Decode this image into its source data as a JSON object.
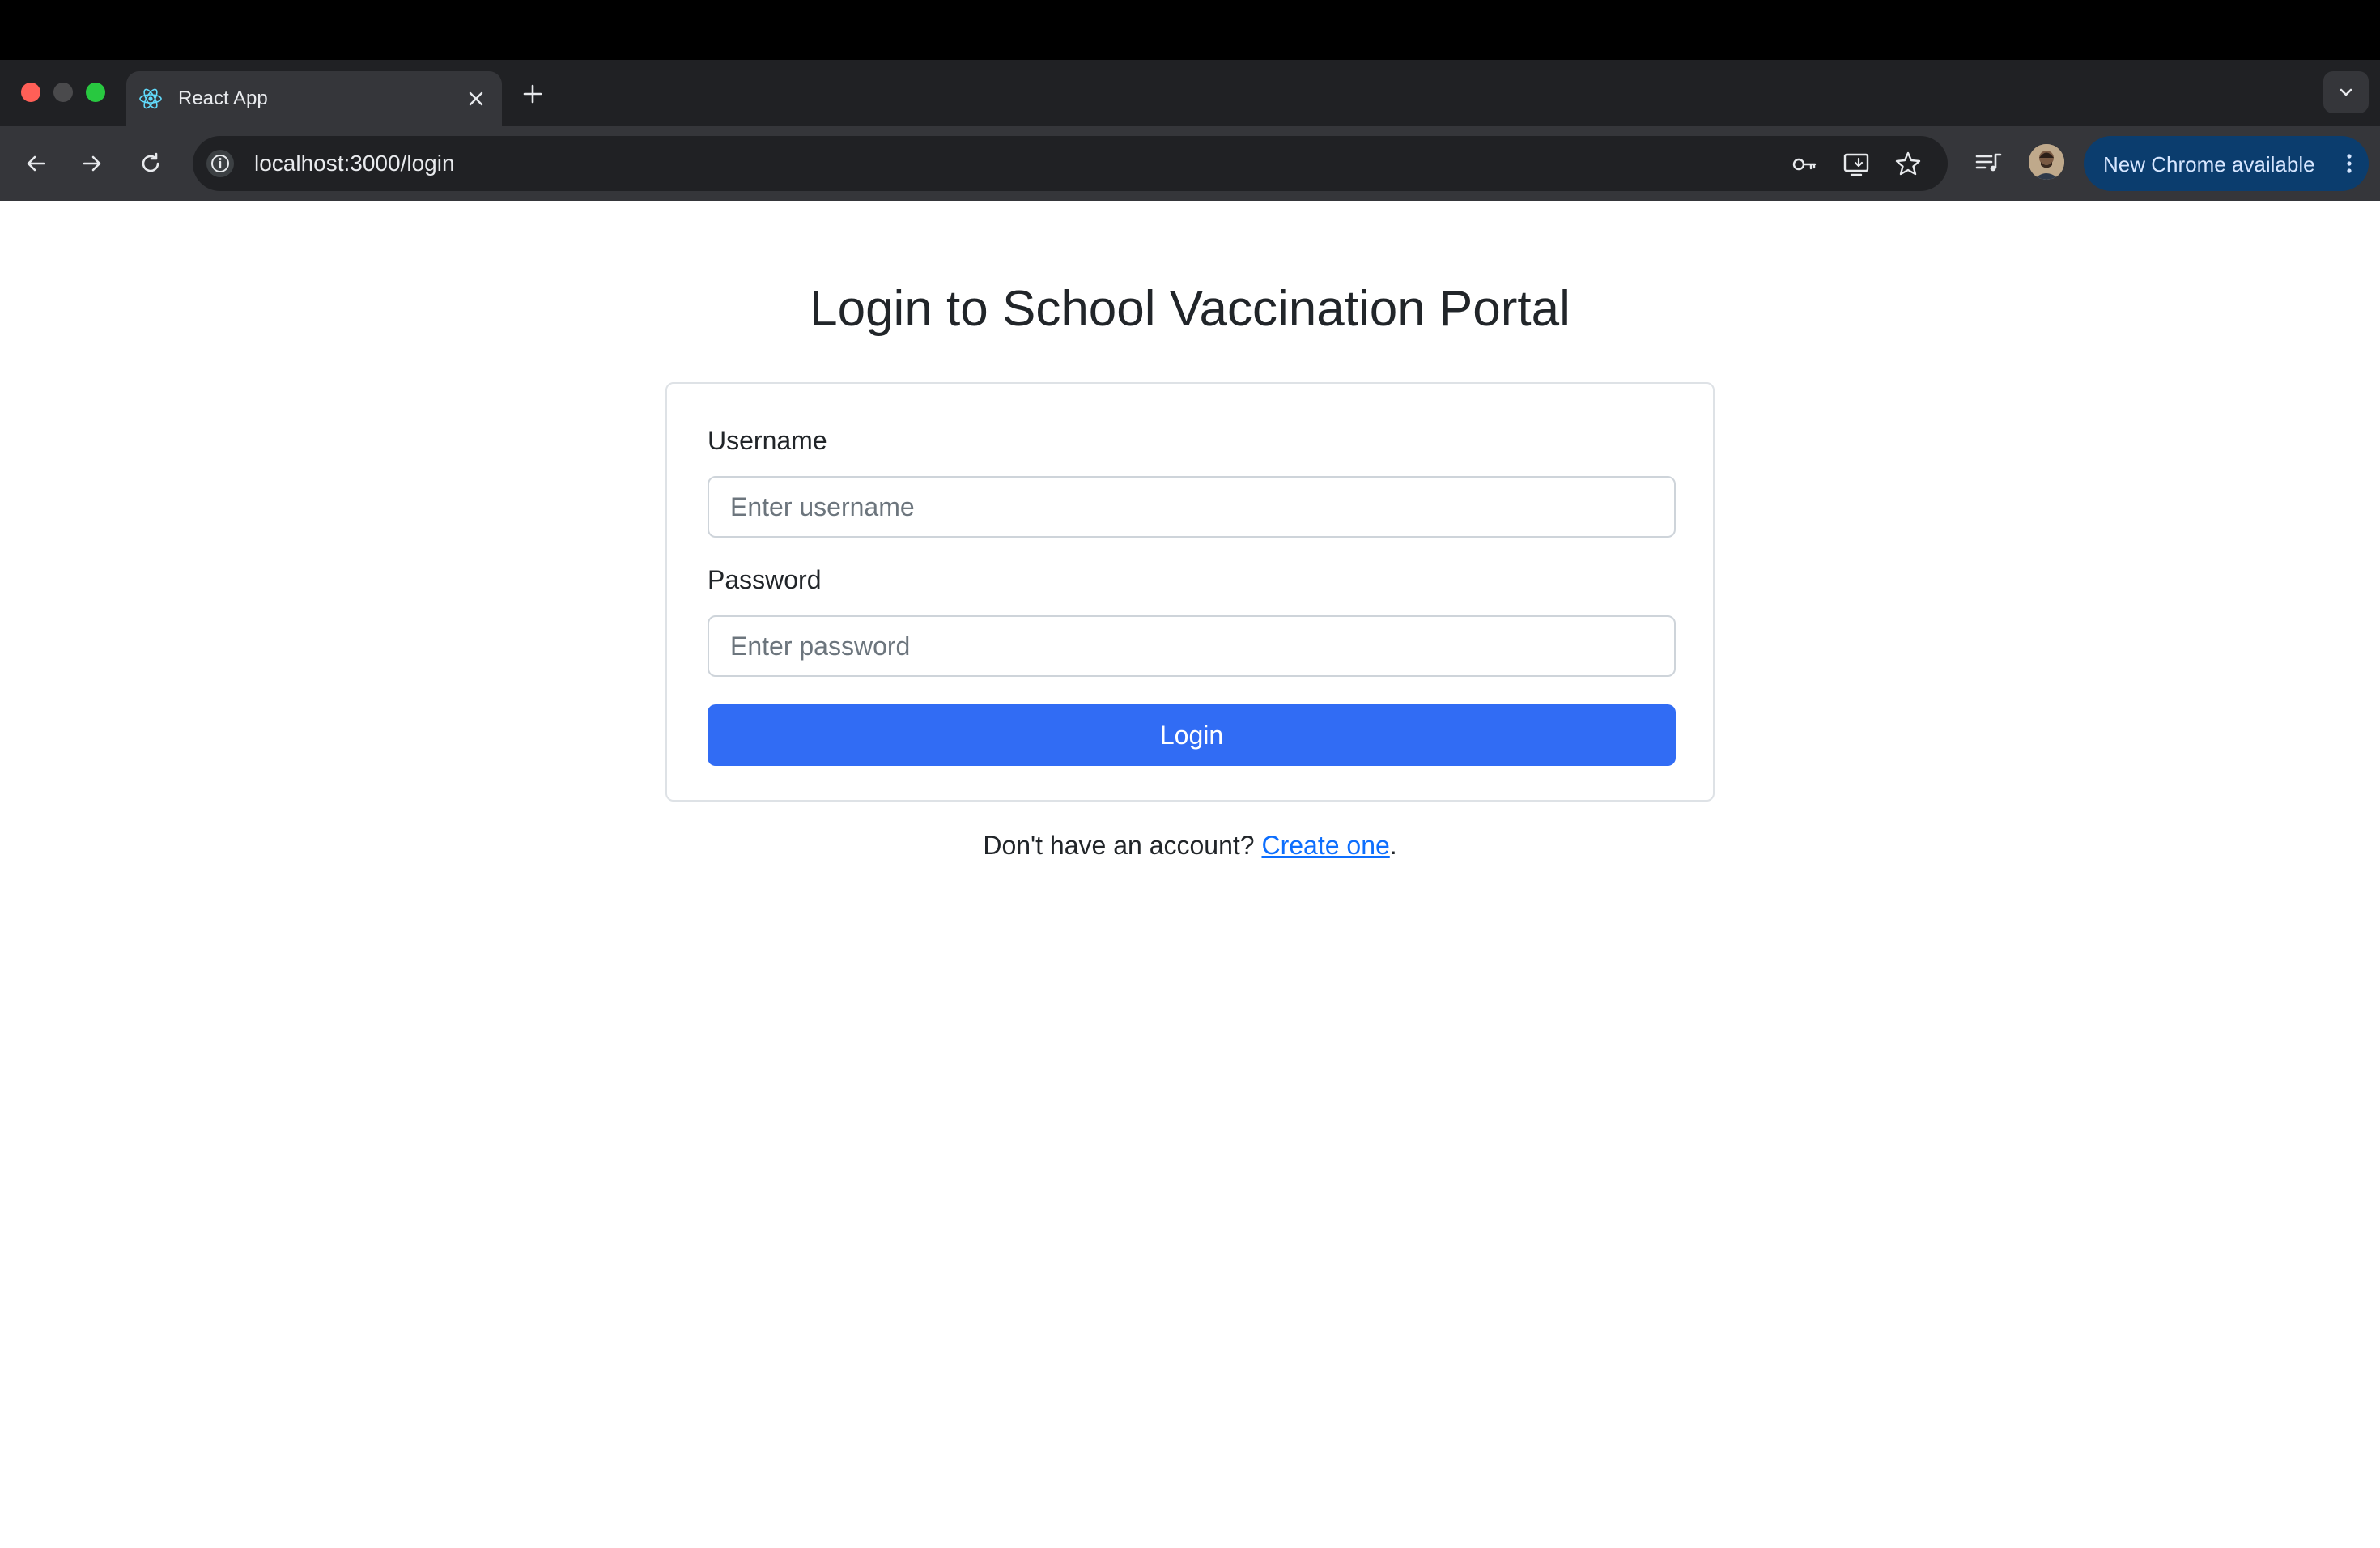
{
  "browser": {
    "tab": {
      "title": "React App"
    },
    "address_bar": {
      "url": "localhost:3000/login"
    },
    "update_button": {
      "label": "New Chrome available"
    }
  },
  "page": {
    "title": "Login to School Vaccination Portal",
    "form": {
      "username_label": "Username",
      "username_placeholder": "Enter username",
      "username_value": "",
      "password_label": "Password",
      "password_placeholder": "Enter password",
      "password_value": "",
      "submit_label": "Login"
    },
    "signup": {
      "prompt": "Don't have an account? ",
      "link_text": "Create one",
      "suffix": "."
    }
  },
  "colors": {
    "primary_button": "#316cf4",
    "link": "#0d6efd",
    "chrome_dark": "#35363a"
  }
}
